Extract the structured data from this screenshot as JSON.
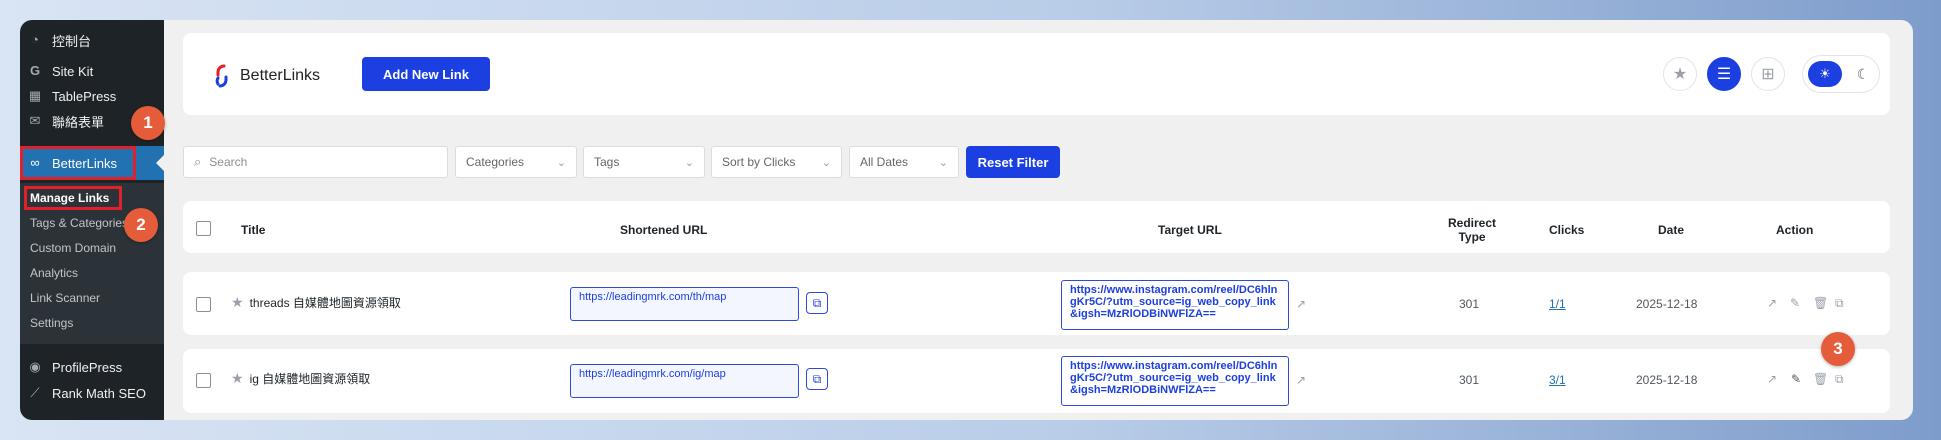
{
  "sidebar": {
    "items": [
      {
        "label": "控制台",
        "icon": "dashboard-icon"
      },
      {
        "label": "Site Kit",
        "icon": "google-g-icon"
      },
      {
        "label": "TablePress",
        "icon": "table-icon"
      },
      {
        "label": "聯絡表單",
        "icon": "mail-icon"
      },
      {
        "label": "BetterLinks",
        "icon": "link-icon"
      },
      {
        "label": "ProfilePress",
        "icon": "profilepress-icon"
      },
      {
        "label": "Rank Math SEO",
        "icon": "rank-math-icon"
      }
    ],
    "submenu": [
      "Manage Links",
      "Tags & Categories",
      "Custom Domain",
      "Analytics",
      "Link Scanner",
      "Settings"
    ]
  },
  "annotations": [
    "1",
    "2",
    "3"
  ],
  "header": {
    "brand": "BetterLinks",
    "add_button": "Add New Link",
    "view_icons": [
      "star-icon",
      "list-view-icon",
      "grid-view-icon"
    ],
    "theme_icons": [
      "sun-icon",
      "moon-icon"
    ]
  },
  "filters": {
    "search_placeholder": "Search",
    "categories": "Categories",
    "tags": "Tags",
    "sort": "Sort by Clicks",
    "dates": "All Dates",
    "reset": "Reset Filter"
  },
  "table": {
    "headers": {
      "title": "Title",
      "short": "Shortened URL",
      "target": "Target URL",
      "redirect_1": "Redirect",
      "redirect_2": "Type",
      "clicks": "Clicks",
      "date": "Date",
      "action": "Action"
    },
    "rows": [
      {
        "title": "threads 自媒體地圖資源領取",
        "short": "https://leadingmrk.com/th/map",
        "target": "https://www.instagram.com/reel/DC6hlngKr5C/?utm_source=ig_web_copy_link&igsh=MzRlODBiNWFlZA==",
        "redirect": "301",
        "clicks": "1/1",
        "date": "2025-12-18"
      },
      {
        "title": "ig 自媒體地圖資源領取",
        "short": "https://leadingmrk.com/ig/map",
        "target": "https://www.instagram.com/reel/DC6hlngKr5C/?utm_source=ig_web_copy_link&igsh=MzRlODBiNWFlZA==",
        "redirect": "301",
        "clicks": "3/1",
        "date": "2025-12-18"
      }
    ]
  },
  "colors": {
    "accent": "#1b3fe0",
    "wp_admin": "#1d2327",
    "highlight": "#e0212b",
    "badge": "#e55c3a"
  }
}
